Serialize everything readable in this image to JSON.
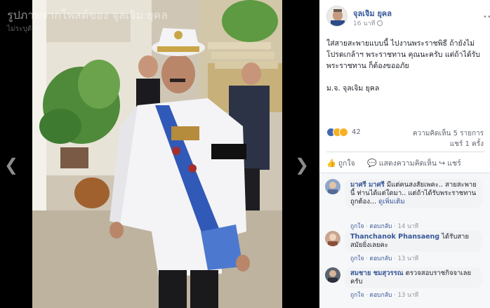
{
  "viewer": {
    "photo_title": "รูปภาพจากโพสต์ของ จุลเจิม ยุคล",
    "photo_subtitle": "ไม่ระบุตัวตน",
    "prev_glyph": "❮",
    "next_glyph": "❯"
  },
  "post": {
    "author": "จุลเจิม ยุคล",
    "time": "16 นาที",
    "more": "•••",
    "paragraphs": [
      "ใส่สายสะพายแบบนี้ ไปงานพระราชพิธี ถ้ายังไม่โปรดเกล้าฯ พระราชทาน คุณนะครับ แต่ถ้าได้รับพระราชทาน ก็ต้องขออภัย",
      "ม.จ. จุลเจิม ยุคล"
    ],
    "reaction_count": "42",
    "comments_count": "ความคิดเห็น 5 รายการ",
    "shares_count": "แชร์ 1 ครั้ง"
  },
  "actions": {
    "like": "ถูกใจ",
    "comment": "แสดงความคิดเห็น",
    "share": "แชร์",
    "like_icon": "👍",
    "comment_icon": "💬",
    "share_icon": "↪"
  },
  "comments": [
    {
      "name": "มาศรี มาศรี",
      "text": "มีแต่คนสงสัยเพคะ.. สายสะพายนี้ ท่านได้แต่ใดมา.. แต่ถ้าได้รับพระราชทานถูกต้อง...",
      "more": "ดูเพิ่มเติม",
      "like": "ถูกใจ",
      "reply": "ตอบกลับ",
      "time": "14 นาที"
    },
    {
      "name": "Thanchanok Phansaeng",
      "text": "ได้รับสายสมัยยิ่งเลยคะ",
      "like": "ถูกใจ",
      "reply": "ตอบกลับ",
      "time": "13 นาที"
    },
    {
      "name": "สมชาย ชมสุวรรณ",
      "text": "ตรวจสอบราชกิจจาเลยครับ",
      "like": "ถูกใจ",
      "reply": "ตอบกลับ",
      "time": "13 นาที"
    }
  ],
  "colors": {
    "link": "#385898",
    "like_blue": "#4267b2",
    "muted": "#90949c"
  }
}
